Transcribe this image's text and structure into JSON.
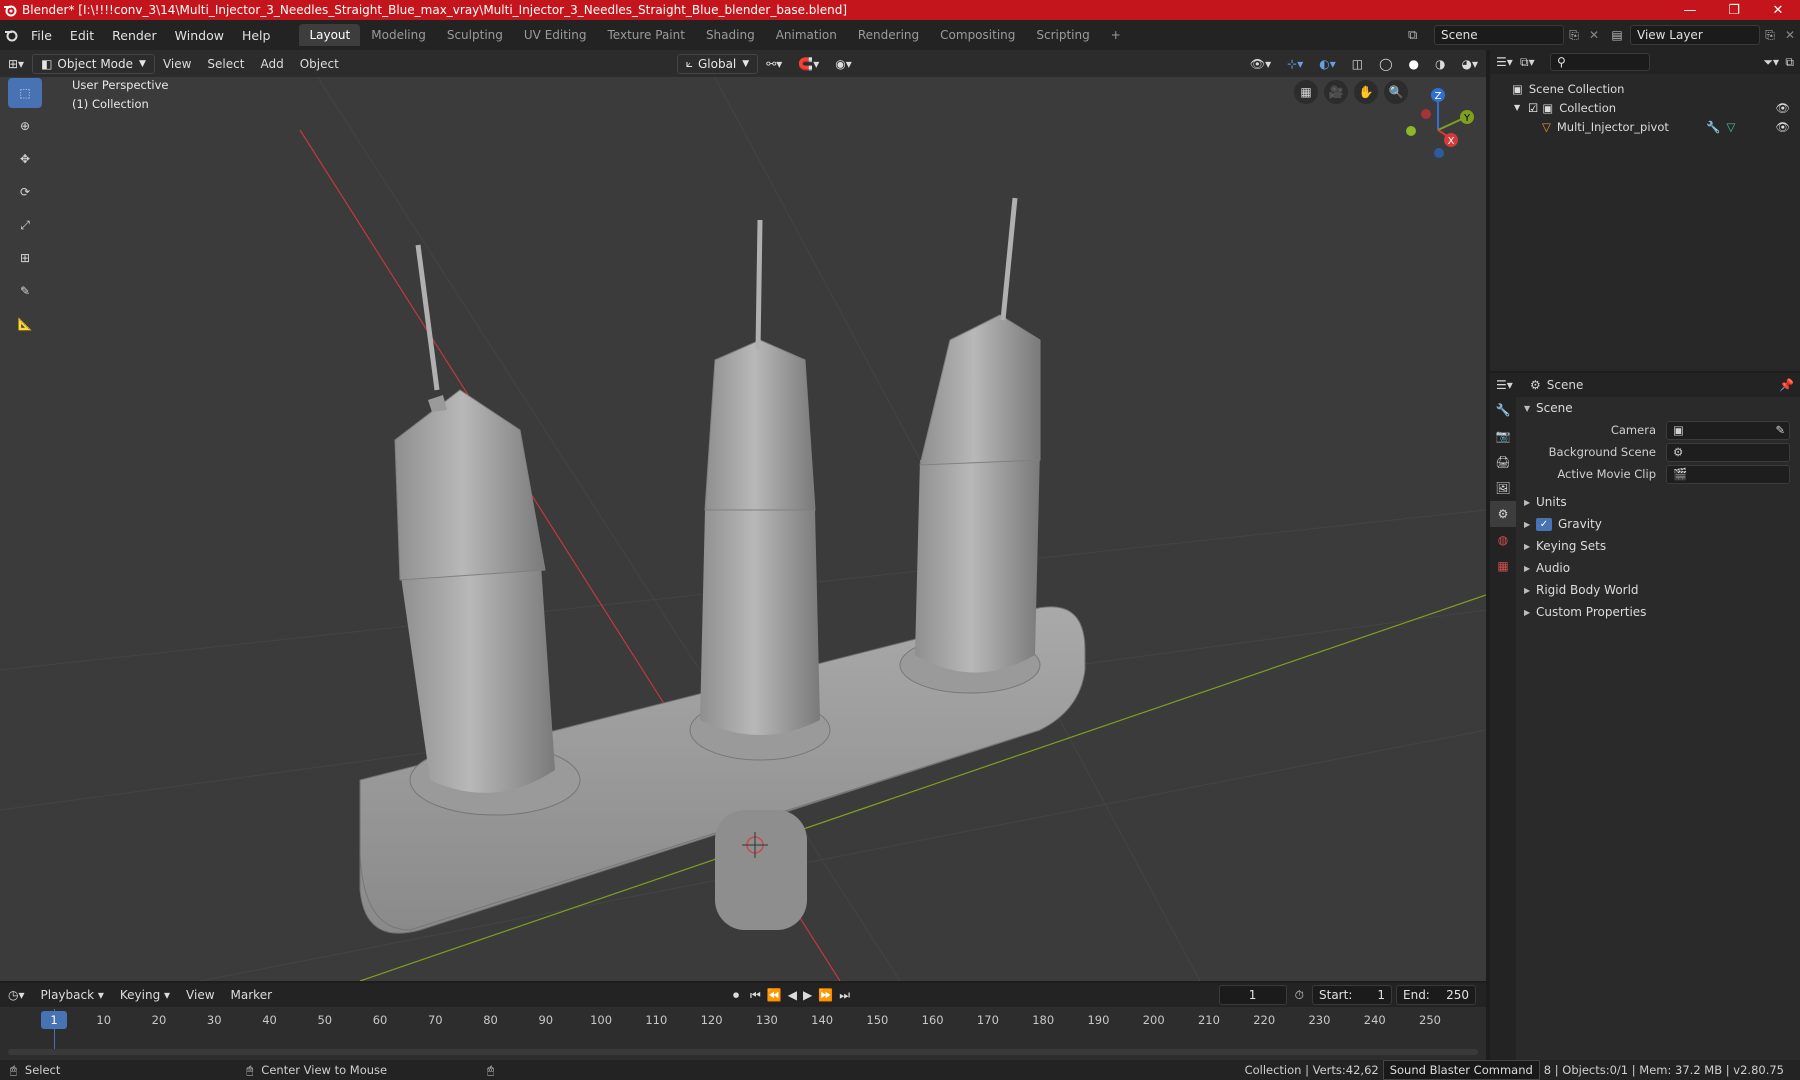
{
  "titlebar": {
    "title": "Blender* [I:\\!!!!conv_3\\14\\Multi_Injector_3_Needles_Straight_Blue_max_vray\\Multi_Injector_3_Needles_Straight_Blue_blender_base.blend]",
    "minimize": "—",
    "maximize": "❐",
    "close": "✕"
  },
  "menu": [
    "File",
    "Edit",
    "Render",
    "Window",
    "Help"
  ],
  "workspaces": [
    "Layout",
    "Modeling",
    "Sculpting",
    "UV Editing",
    "Texture Paint",
    "Shading",
    "Animation",
    "Rendering",
    "Compositing",
    "Scripting"
  ],
  "workspace_add": "+",
  "scene_field": "Scene",
  "view_layer_field": "View Layer",
  "viewport": {
    "mode": "Object Mode",
    "header_menu": [
      "View",
      "Select",
      "Add",
      "Object"
    ],
    "orientation": "Global",
    "info_line1": "User Perspective",
    "info_line2": "(1) Collection",
    "gizmo": {
      "x": "X",
      "y": "Y",
      "z": "Z"
    }
  },
  "outliner": {
    "root": "Scene Collection",
    "collection": "Collection",
    "object": "Multi_Injector_pivot"
  },
  "properties": {
    "context": "Scene",
    "panel_title": "Scene",
    "camera_label": "Camera",
    "background_label": "Background Scene",
    "movieclip_label": "Active Movie Clip",
    "subpanels": [
      "Units",
      "Gravity",
      "Keying Sets",
      "Audio",
      "Rigid Body World",
      "Custom Properties"
    ]
  },
  "timeline": {
    "menu": [
      "Playback",
      "Keying",
      "View",
      "Marker"
    ],
    "current_frame": "1",
    "start_label": "Start:",
    "start_value": "1",
    "end_label": "End:",
    "end_value": "250",
    "ticks": [
      "1",
      "10",
      "20",
      "30",
      "40",
      "50",
      "60",
      "70",
      "80",
      "90",
      "100",
      "110",
      "120",
      "130",
      "140",
      "150",
      "160",
      "170",
      "180",
      "190",
      "200",
      "210",
      "220",
      "230",
      "240",
      "250"
    ]
  },
  "statusbar": {
    "select": "Select",
    "center": "Center View to Mouse",
    "stats_left": "Collection | Verts:42,62",
    "tooltip": "Sound Blaster Command",
    "stats_right": "8 | Objects:0/1 | Mem: 37.2 MB | v2.80.75"
  },
  "colors": {
    "titlebar": "#c5151c",
    "accent": "#4772b3",
    "viewport_bg": "#3b3b3b",
    "x_axis": "#c0393f",
    "y_axis": "#7fa01f"
  }
}
